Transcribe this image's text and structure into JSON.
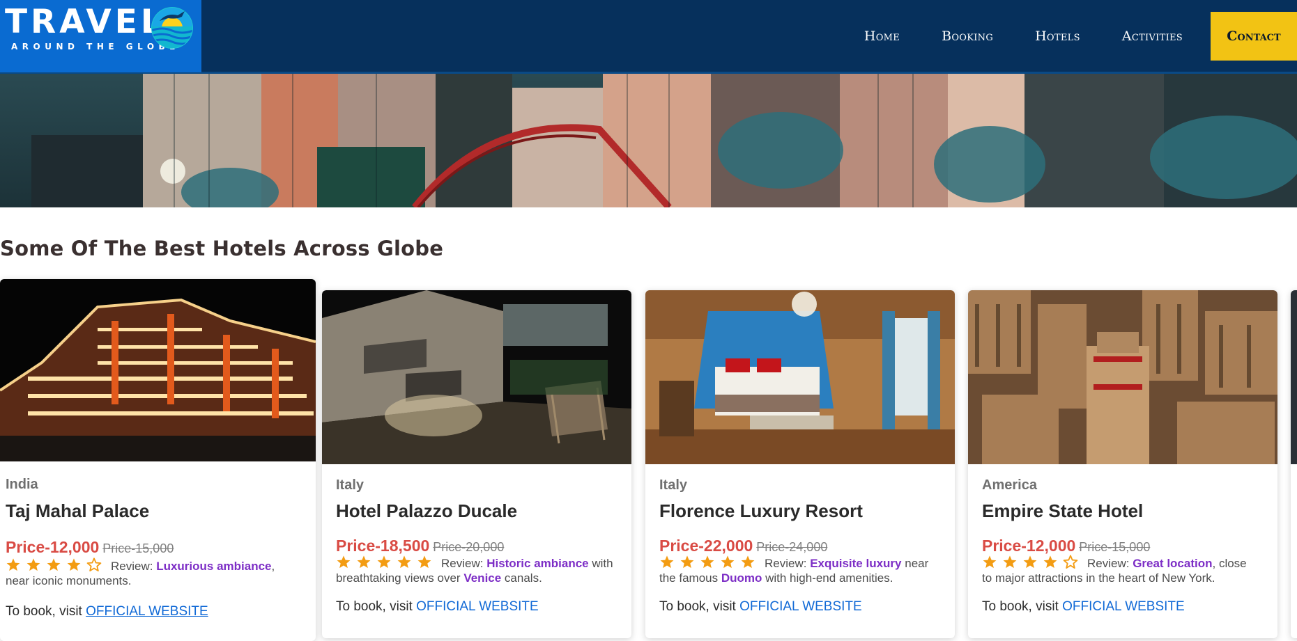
{
  "logo": {
    "word": "TRAVEL",
    "tagline": "AROUND THE GLOBE"
  },
  "nav": {
    "home": "Home",
    "booking": "Booking",
    "hotels": "Hotels",
    "activities": "Activities",
    "contact": "Contact"
  },
  "section_title": "Some Of The Best Hotels Across Globe",
  "review_prefix": "Review: ",
  "book_prefix": "To book, visit ",
  "colors": {
    "nav_bg": "#06305c",
    "logo_bg": "#0a6bd1",
    "contact_bg": "#f2c314",
    "price": "#d94b44",
    "highlight": "#7d2ec6",
    "link": "#1069d6",
    "star": "#f39c12"
  },
  "cards": [
    {
      "country": "India",
      "name": "Taj Mahal Palace",
      "price_new": "Price-12,000",
      "price_old": "Price-15,000",
      "rating": 4,
      "review_highlight": "Luxurious ambiance",
      "review_after": ",",
      "review_line2": "near iconic monuments.",
      "link": "OFFICIAL WEBSITE",
      "image_icon": "illuminated-hotel-photo"
    },
    {
      "country": "Italy",
      "name": "Hotel Palazzo Ducale",
      "price_new": "Price-18,500",
      "price_old": "Price-20,000",
      "rating": 5,
      "review_highlight": "Historic ambiance",
      "review_after": " with",
      "review_line2_pre": "breathtaking views over ",
      "review_line2_hl": "Venice",
      "review_line2_post": " canals.",
      "link": "OFFICIAL WEBSITE",
      "image_icon": "courtyard-photo"
    },
    {
      "country": "Italy",
      "name": "Florence Luxury Resort",
      "price_new": "Price-22,000",
      "price_old": "Price-24,000",
      "rating": 5,
      "review_highlight": "Exquisite luxury",
      "review_after": " near",
      "review_line2_pre": "the famous ",
      "review_line2_hl": "Duomo",
      "review_line2_post": " with high-end amenities.",
      "link": "OFFICIAL WEBSITE",
      "image_icon": "bedroom-photo"
    },
    {
      "country": "America",
      "name": "Empire State Hotel",
      "price_new": "Price-12,000",
      "price_old": "Price-15,000",
      "rating": 4,
      "review_highlight": "Great location",
      "review_after": ", close",
      "review_line2": "to major attractions in the heart of New York.",
      "link": "OFFICIAL WEBSITE",
      "image_icon": "city-aerial-photo"
    }
  ]
}
